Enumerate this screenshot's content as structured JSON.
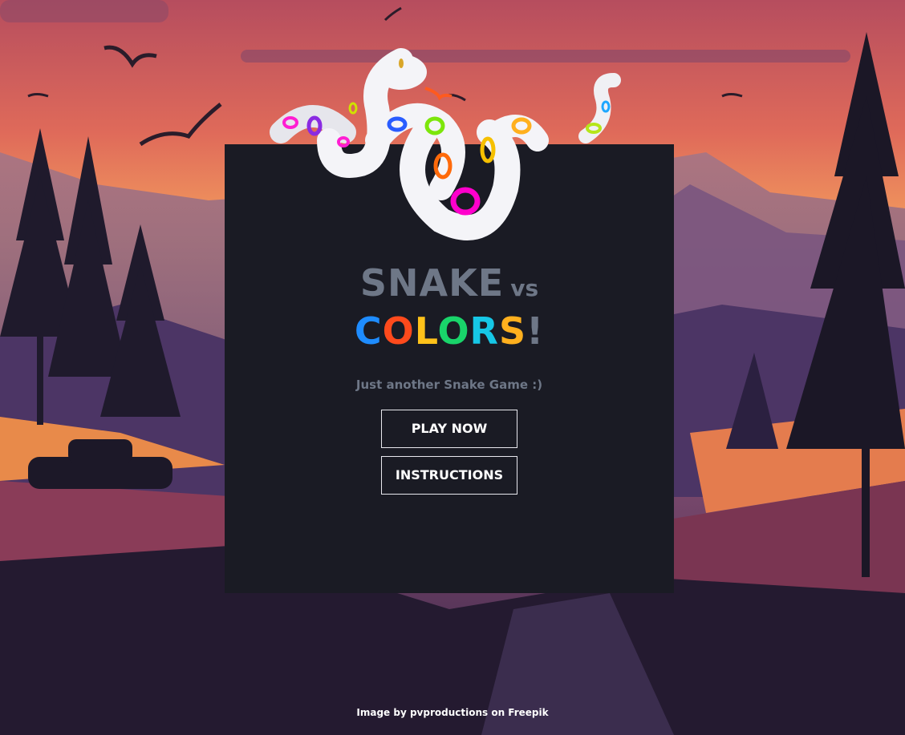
{
  "game": {
    "title_word1": "SNAKE",
    "title_vs": "vs",
    "title_word2_letters": [
      {
        "char": "C",
        "color": "#1e8cff"
      },
      {
        "char": "O",
        "color": "#ff4a1c"
      },
      {
        "char": "L",
        "color": "#ffc21a"
      },
      {
        "char": "O",
        "color": "#19d46a"
      },
      {
        "char": "R",
        "color": "#16c7e6"
      },
      {
        "char": "S",
        "color": "#ffb01e"
      },
      {
        "char": "!",
        "color": "#6e7787"
      }
    ],
    "subtitle": "Just another Snake Game :)"
  },
  "menu": {
    "play_label": "PLAY NOW",
    "instructions_label": "INSTRUCTIONS"
  },
  "footer": {
    "credit": "Image by pvproductions on Freepik"
  },
  "colors": {
    "panel": "#1a1b24",
    "title_gray": "#6e7787",
    "button_border": "#e8e8ee"
  }
}
